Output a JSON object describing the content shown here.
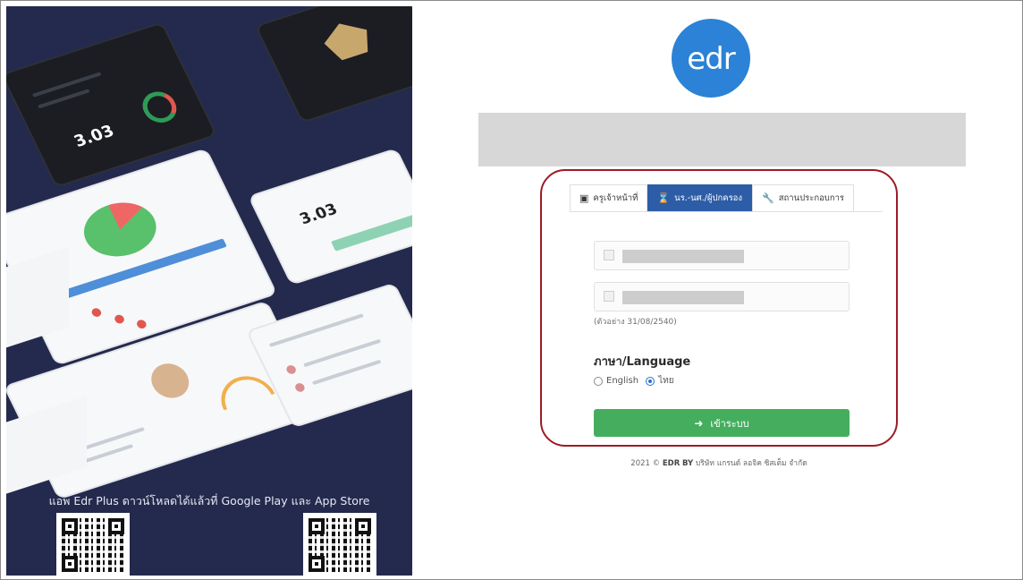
{
  "promo": {
    "caption": "แอพ Edr Plus ดาวน์โหลดได้แล้วที่ Google Play และ App Store",
    "mock_score_1": "3.03",
    "mock_score_2": "3.03",
    "colors": {
      "background": "#242a4d",
      "green": "#45ae5e",
      "red": "#e0574f"
    }
  },
  "logo": {
    "text": "edr"
  },
  "login": {
    "tabs": [
      {
        "icon": "teacher-icon",
        "label": "ครูเจ้าหน้าที่",
        "active": false
      },
      {
        "icon": "hourglass-icon",
        "label": "นร.-นศ./ผู้ปกครอง",
        "active": true
      },
      {
        "icon": "wrench-icon",
        "label": "สถานประกอบการ",
        "active": false
      }
    ],
    "birthdate_hint": "(ตัวอย่าง 31/08/2540)",
    "language_title": "ภาษา/Language",
    "language_options": [
      {
        "label": "English",
        "checked": false
      },
      {
        "label": "ไทย",
        "checked": true
      }
    ],
    "submit_label": "เข้าระบบ",
    "colors": {
      "tab_active": "#2e5da8",
      "submit": "#45ae5e",
      "highlight": "#9c1c25"
    }
  },
  "footer": {
    "year": "2021 ©",
    "brand": "EDR",
    "by": "BY",
    "company": "บริษัท แกรนด์ ลอจิค ซิสเต็ม จำกัด"
  }
}
